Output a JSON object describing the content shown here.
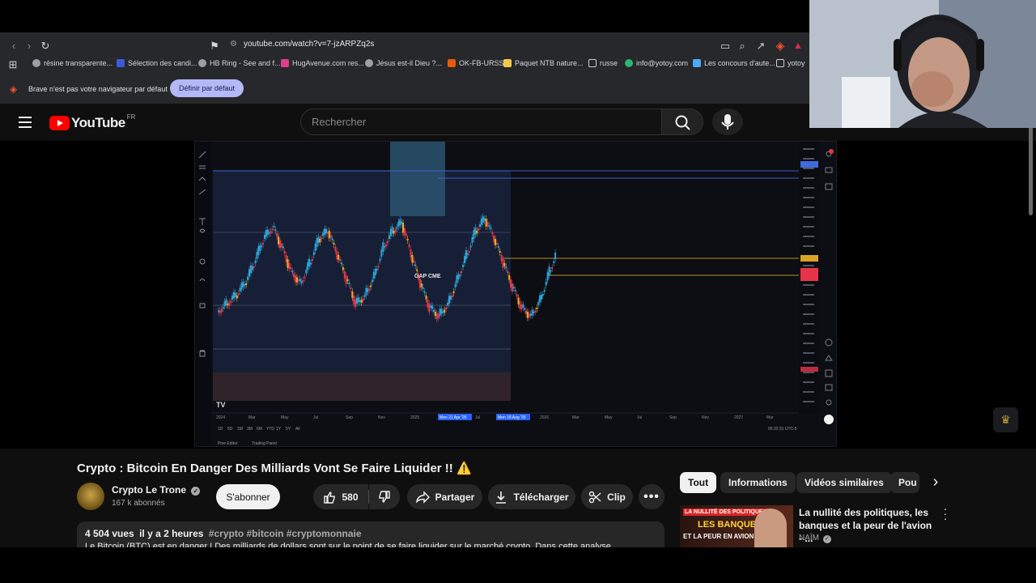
{
  "browser": {
    "url": "youtube.com/watch?v=7-jzARPZq2s",
    "bookmarks": [
      {
        "label": "résine transparente...",
        "color": "#9aa0a8"
      },
      {
        "label": "Sélection des candi...",
        "color": "#3b5bdb"
      },
      {
        "label": "HB Ring - See and f...",
        "color": "#9aa0a8"
      },
      {
        "label": "HugAvenue.com res...",
        "color": "#e03d8a"
      },
      {
        "label": "Jésus est-il Dieu ?...",
        "color": "#9aa0a8"
      },
      {
        "label": "OK-FB-URSS",
        "color": "#e8590c"
      },
      {
        "label": "Paquet NTB nature...",
        "color": "#f2c94c"
      },
      {
        "label": "russe",
        "color": "#9aa0a8"
      },
      {
        "label": "info@yotoy.com",
        "color": "#2bb673"
      },
      {
        "label": "Les concours d'aute...",
        "color": "#4dabf7"
      },
      {
        "label": "yotoy",
        "color": "#9aa0a8"
      }
    ],
    "infobar_text": "Brave n'est pas votre navigateur par défaut",
    "default_button": "Définir par défaut"
  },
  "youtube": {
    "logo_text": "YouTube",
    "region": "FR",
    "search_placeholder": "Rechercher"
  },
  "video_chart": {
    "annotation": "GAP CME",
    "bottom_left_tabs": [
      "Pine Editor",
      "Trading Panel"
    ],
    "time_label": "05:22:31 UTC-5",
    "periods": [
      "1D",
      "5D",
      "1M",
      "3M",
      "6M",
      "YTD",
      "1Y",
      "5Y",
      "All"
    ],
    "x_ticks": [
      "2024",
      "Mar",
      "May",
      "Jul",
      "Sep",
      "Nov",
      "2025",
      "Mar",
      "Jul",
      "Nov",
      "2026",
      "Mar",
      "May",
      "Jul",
      "Sep",
      "Nov",
      "2027",
      "Mar"
    ],
    "date_badges": [
      "Mon 21 Apr '25",
      "Mon 18 Aug '25"
    ]
  },
  "video": {
    "title": "Crypto : Bitcoin En Danger Des Milliards Vont Se Faire Liquider !!",
    "title_emoji": "⚠️",
    "channel": "Crypto Le Trone",
    "subscribers": "167 k abonnés",
    "subscribe": "S'abonner",
    "likes": "580",
    "share": "Partager",
    "download": "Télécharger",
    "clip": "Clip",
    "views": "4 504 vues",
    "posted": "il y a 2 heures",
    "hashtags": "#crypto #bitcoin #cryptomonnaie",
    "description": "Le Bitcoin (BTC) est en danger ! Des milliards de dollars sont sur le point de se faire liquider sur le marché crypto. Dans cette analyse"
  },
  "filters": [
    "Tout",
    "Informations",
    "Vidéos similaires",
    "Pou"
  ],
  "recommendation": {
    "title": "La nullité des politiques, les banques et la peur de l'avion - ...",
    "channel": "NAÏM",
    "thumb_line1": "LA NULLITÉ DES POLITIQUES",
    "thumb_line2": "LES BANQUES",
    "thumb_line3": "ET LA PEUR EN AVION"
  },
  "colors": {
    "brave_orange": "#fb542b",
    "youtube_red": "#ff0000",
    "chart_bg": "#0c0e14",
    "candle_up": "#2ea4d6",
    "candle_down": "#e8344a",
    "candle_wick_yellow": "#e8b020",
    "level_blue": "#3f6bdc",
    "level_yellow": "#d9a323"
  }
}
